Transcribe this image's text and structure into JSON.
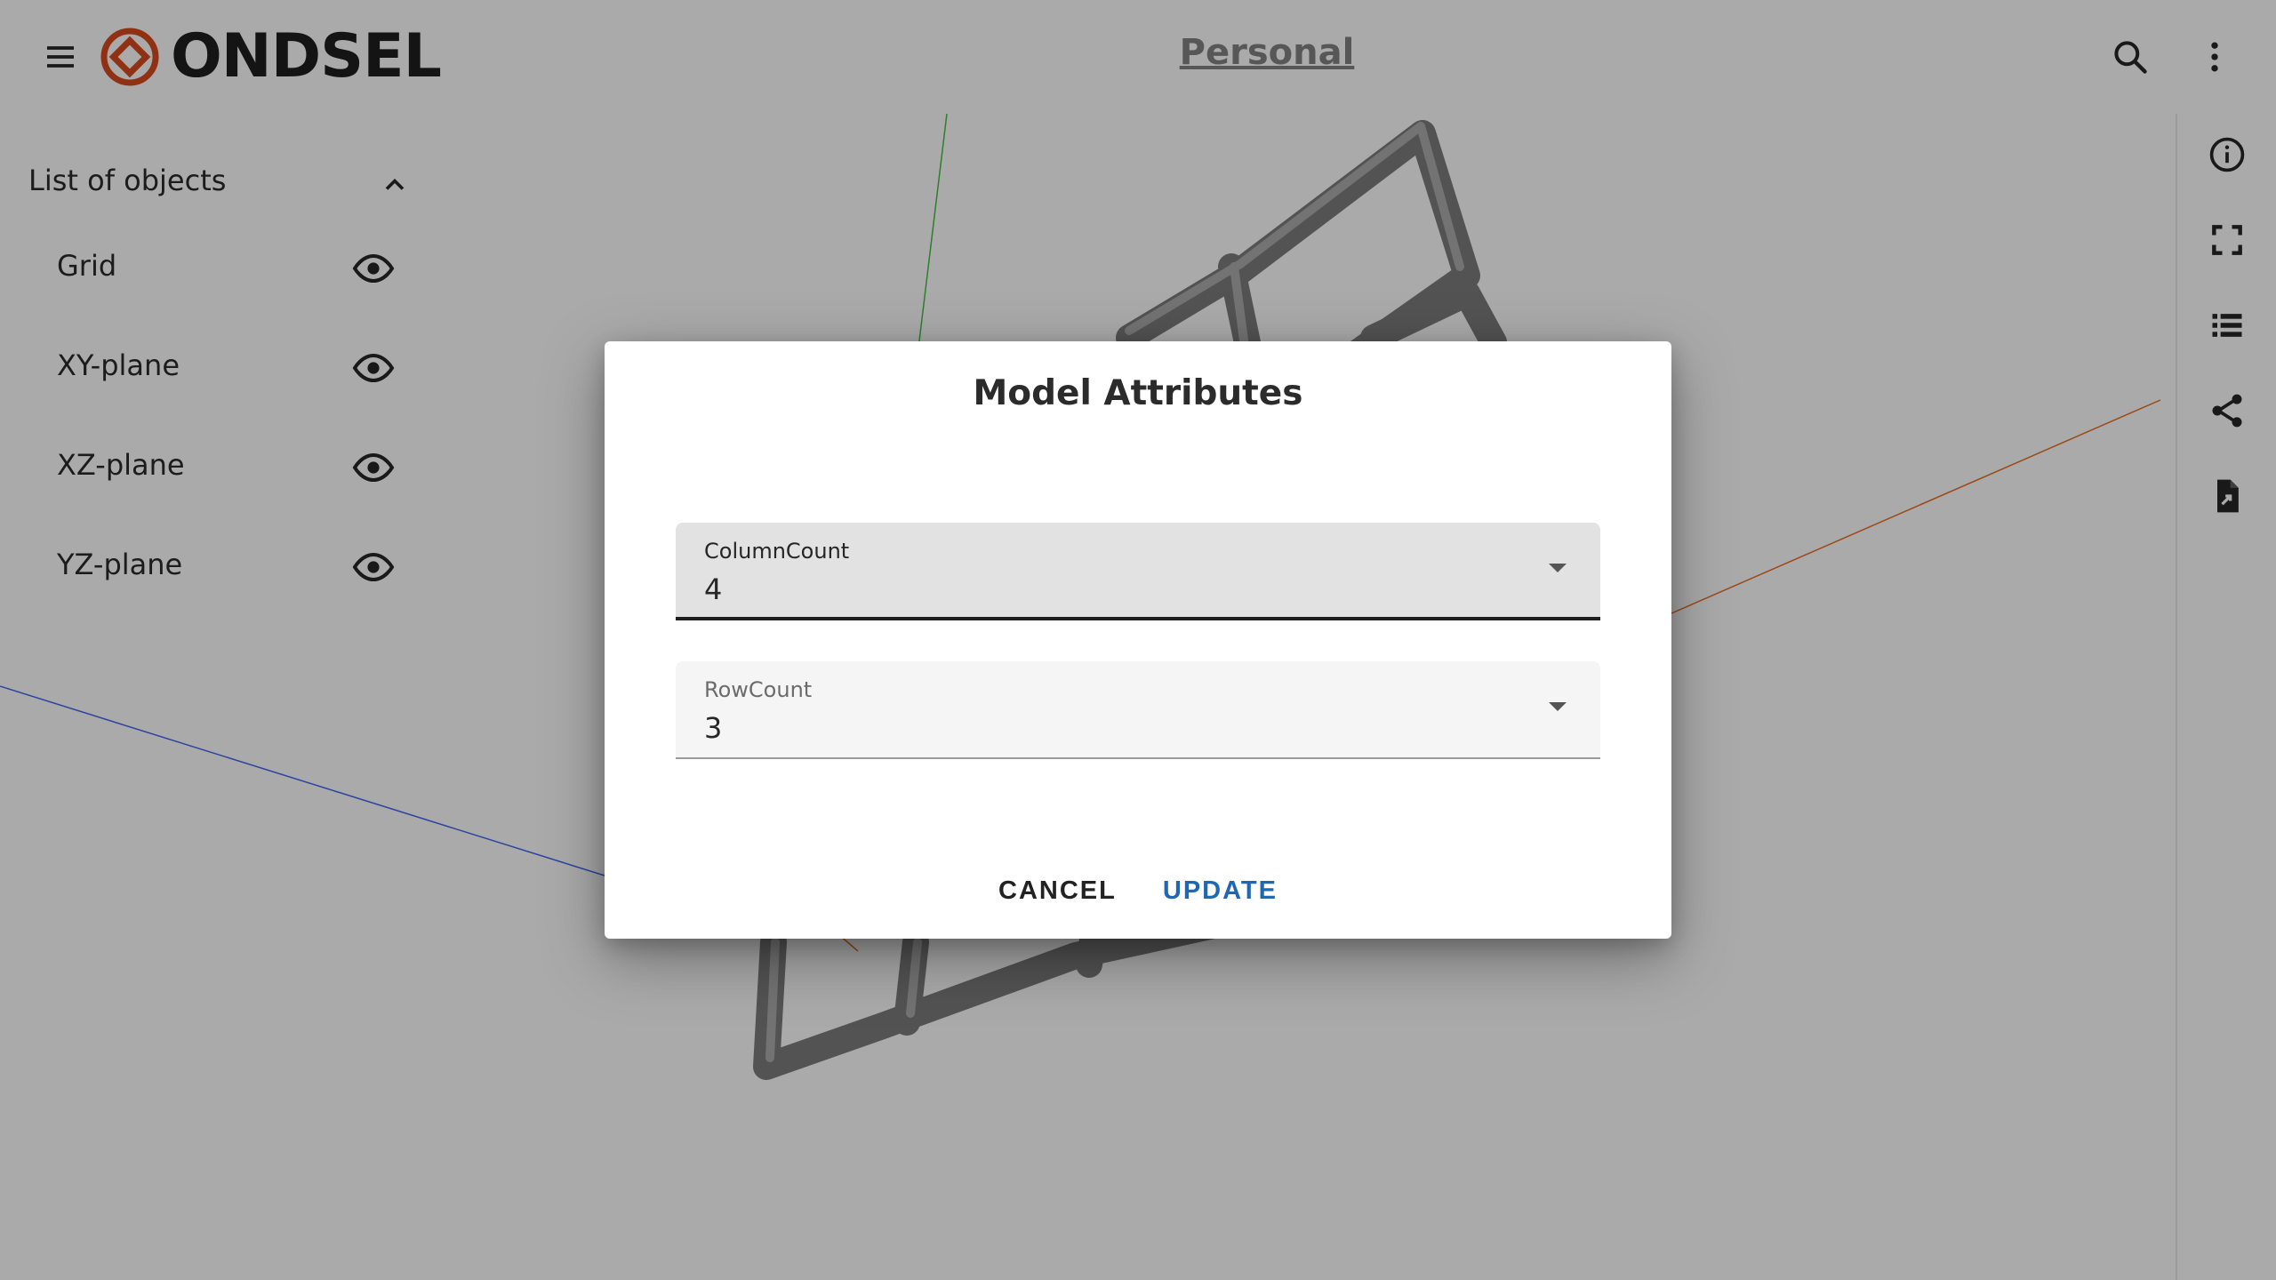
{
  "app": {
    "brand": "ONDSEL",
    "workspace": "Personal",
    "brand_color": "#c2421a"
  },
  "left_panel": {
    "title": "List of objects",
    "items": [
      {
        "label": "Grid"
      },
      {
        "label": "XY-plane"
      },
      {
        "label": "XZ-plane"
      },
      {
        "label": "YZ-plane"
      }
    ]
  },
  "icons": {
    "menu": "hamburger-menu-icon",
    "search": "search-icon",
    "more": "more-vertical-icon",
    "info": "info-icon",
    "fullscreen": "fullscreen-icon",
    "list": "list-icon",
    "share": "share-icon",
    "export": "file-export-icon"
  },
  "dialog": {
    "title": "Model Attributes",
    "fields": [
      {
        "label": "ColumnCount",
        "value": "4"
      },
      {
        "label": "RowCount",
        "value": "3"
      }
    ],
    "cancel_label": "CANCEL",
    "update_label": "UPDATE",
    "accent_color": "#1f66b3"
  }
}
